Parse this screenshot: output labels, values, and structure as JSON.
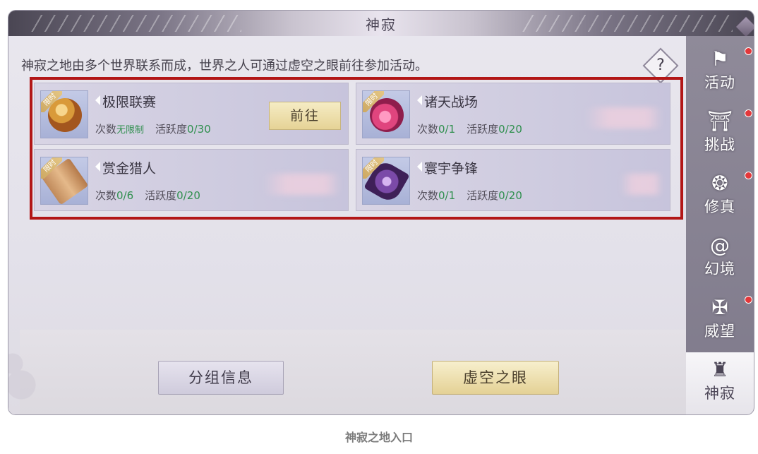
{
  "window": {
    "title": "神寂"
  },
  "description": "神寂之地由多个世界联系而成，世界之人可通过虚空之眼前往参加活动。",
  "help_label": "?",
  "limited_tag": "限时",
  "cards": [
    {
      "name": "极限联赛",
      "count_label": "次数",
      "count_value": "无限制",
      "activity_label": "活跃度",
      "activity_value": "0/30",
      "button": "前往",
      "icon": "gang-emblem-icon"
    },
    {
      "name": "诸天战场",
      "count_label": "次数",
      "count_value": "0/1",
      "activity_label": "活跃度",
      "activity_value": "0/20",
      "icon": "pink-flame-icon"
    },
    {
      "name": "赏金猎人",
      "count_label": "次数",
      "count_value": "0/6",
      "activity_label": "活跃度",
      "activity_value": "0/20",
      "icon": "bounty-scroll-icon"
    },
    {
      "name": "寰宇争锋",
      "count_label": "次数",
      "count_value": "0/1",
      "activity_label": "活跃度",
      "activity_value": "0/20",
      "icon": "purple-crystal-icon"
    }
  ],
  "buttons": {
    "group_info": "分组信息",
    "void_eye": "虚空之眼"
  },
  "sidebar": [
    {
      "label": "活动",
      "icon": "banner-icon",
      "badge": true
    },
    {
      "label": "挑战",
      "icon": "gate-icon",
      "badge": true
    },
    {
      "label": "修真",
      "icon": "swirl-icon",
      "badge": true
    },
    {
      "label": "幻境",
      "icon": "spiral-icon",
      "badge": false
    },
    {
      "label": "威望",
      "icon": "wings-icon",
      "badge": true
    },
    {
      "label": "神寂",
      "icon": "helmet-icon",
      "badge": false,
      "active": true
    }
  ],
  "caption": "神寂之地入口",
  "colors": {
    "highlight": "#b21616",
    "value_green": "#2f8f4e",
    "badge_red": "#e3373a"
  }
}
